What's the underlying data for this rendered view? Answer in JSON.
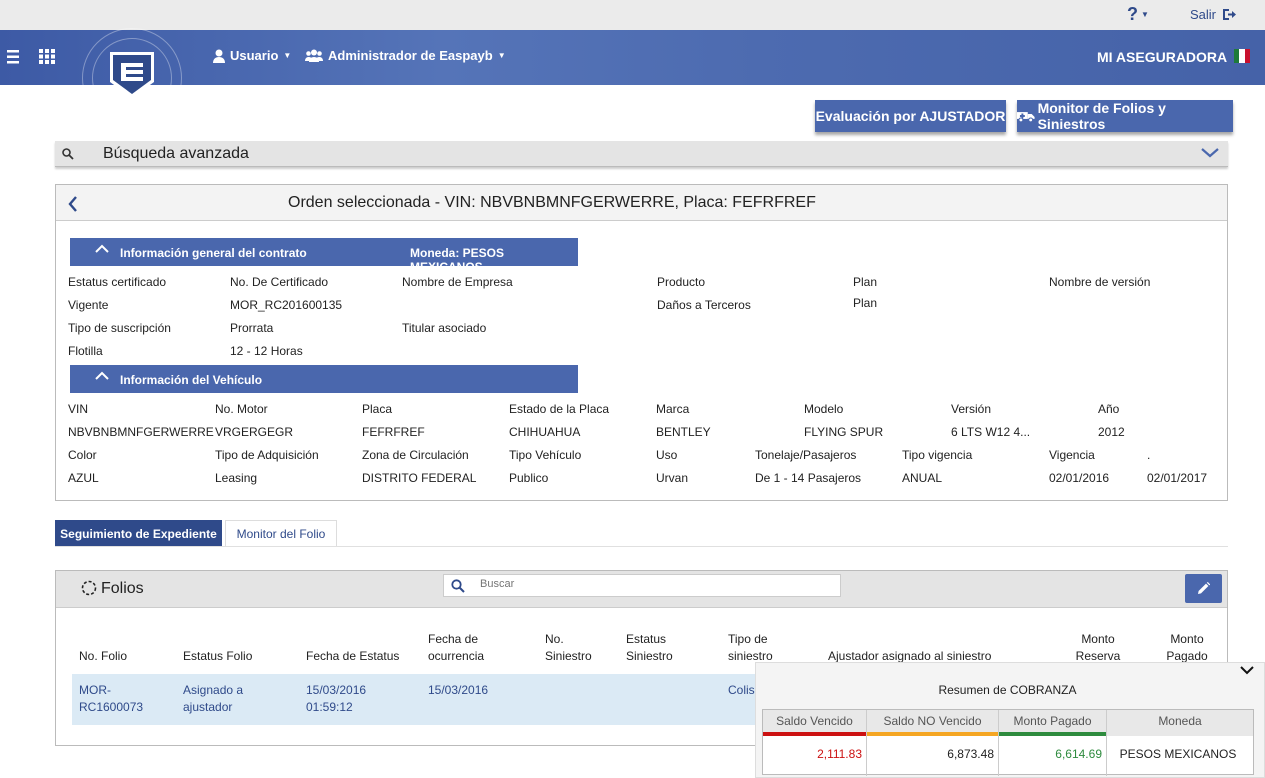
{
  "topbar": {
    "help_label": "?",
    "salir_label": "Salir"
  },
  "navbar": {
    "usuario_label": "Usuario",
    "admin_label": "Administrador de Easpayb",
    "brand": "MI ASEGURADORA"
  },
  "actions": {
    "evaluacion_label": "Evaluación por AJUSTADOR",
    "monitor_label": "Monitor de Folios y Siniestros"
  },
  "busqueda": {
    "title": "Búsqueda avanzada"
  },
  "order": {
    "title": "Orden seleccionada - VIN: NBVBNBMNFGERWERRE, Placa: FEFRFREF",
    "contract": {
      "header": "Información general del contrato",
      "currency": "Moneda: PESOS MEXICANOS",
      "fields": [
        {
          "label": "Estatus certificado",
          "value": "Vigente"
        },
        {
          "label": "No. De Certificado",
          "value": "MOR_RC201600135"
        },
        {
          "label": "Nombre de Empresa",
          "value": ""
        },
        {
          "label": "Producto",
          "value": "Daños a Terceros"
        },
        {
          "label": "Plan",
          "value": "Plan"
        },
        {
          "label": "Nombre de versión",
          "value": ""
        },
        {
          "label": "Tipo de suscripción",
          "value": "Flotilla"
        },
        {
          "label": "Prorrata",
          "value": "12 - 12 Horas"
        },
        {
          "label": "Titular asociado",
          "value": ""
        }
      ]
    },
    "vehicle": {
      "header": "Información del Vehículo",
      "fields": [
        {
          "label": "VIN",
          "value": "NBVBNBMNFGERWERRE"
        },
        {
          "label": "No. Motor",
          "value": "VRGERGEGR"
        },
        {
          "label": "Placa",
          "value": "FEFRFREF"
        },
        {
          "label": "Estado de la Placa",
          "value": "CHIHUAHUA"
        },
        {
          "label": "Marca",
          "value": "BENTLEY"
        },
        {
          "label": "Modelo",
          "value": "FLYING SPUR"
        },
        {
          "label": "Versión",
          "value": "6 LTS W12 4..."
        },
        {
          "label": "Año",
          "value": "2012"
        },
        {
          "label": "Color",
          "value": "AZUL"
        },
        {
          "label": "Tipo de Adquisición",
          "value": "Leasing"
        },
        {
          "label": "Zona de Circulación",
          "value": "DISTRITO FEDERAL"
        },
        {
          "label": "Tipo Vehículo",
          "value": "Publico"
        },
        {
          "label": "Uso",
          "value": "Urvan"
        },
        {
          "label": "Tonelaje/Pasajeros",
          "value": "De 1 - 14 Pasajeros"
        },
        {
          "label": "Tipo vigencia",
          "value": "ANUAL"
        },
        {
          "label": "Vigencia",
          "value": "02/01/2016"
        },
        {
          "label": ".",
          "value": "02/01/2017"
        }
      ]
    }
  },
  "tabs": [
    {
      "label": "Seguimiento de Expediente"
    },
    {
      "label": "Monitor del Folio"
    }
  ],
  "folios": {
    "title": "Folios",
    "search_placeholder": "Buscar",
    "columns": [
      {
        "line1": "",
        "line2": "No. Folio"
      },
      {
        "line1": "",
        "line2": "Estatus Folio"
      },
      {
        "line1": "",
        "line2": "Fecha de Estatus"
      },
      {
        "line1": "Fecha de",
        "line2": "ocurrencia"
      },
      {
        "line1": "No.",
        "line2": "Siniestro"
      },
      {
        "line1": "Estatus",
        "line2": "Siniestro"
      },
      {
        "line1": "Tipo de",
        "line2": "siniestro"
      },
      {
        "line1": "",
        "line2": "Ajustador asignado al siniestro"
      },
      {
        "line1": "Monto",
        "line2": "Reserva"
      },
      {
        "line1": "Monto",
        "line2": "Pagado"
      }
    ],
    "row": {
      "folio": [
        "MOR-",
        "RC1600073"
      ],
      "estatus": [
        "Asignado a",
        "ajustador"
      ],
      "fecha_estatus": [
        "15/03/2016",
        "01:59:12"
      ],
      "fecha_ocurrencia": "15/03/2016",
      "tipo": "Colis"
    }
  },
  "cobranza": {
    "title": "Resumen de COBRANZA",
    "headers": [
      "Saldo Vencido",
      "Saldo NO Vencido",
      "Monto Pagado",
      "Moneda"
    ],
    "values": [
      "2,111.83",
      "6,873.48",
      "6,614.69",
      "PESOS MEXICANOS"
    ],
    "colors": {
      "vencido": "#cc1111",
      "no_vencido": "#f5a623",
      "pagado": "#2e8b3e"
    }
  }
}
